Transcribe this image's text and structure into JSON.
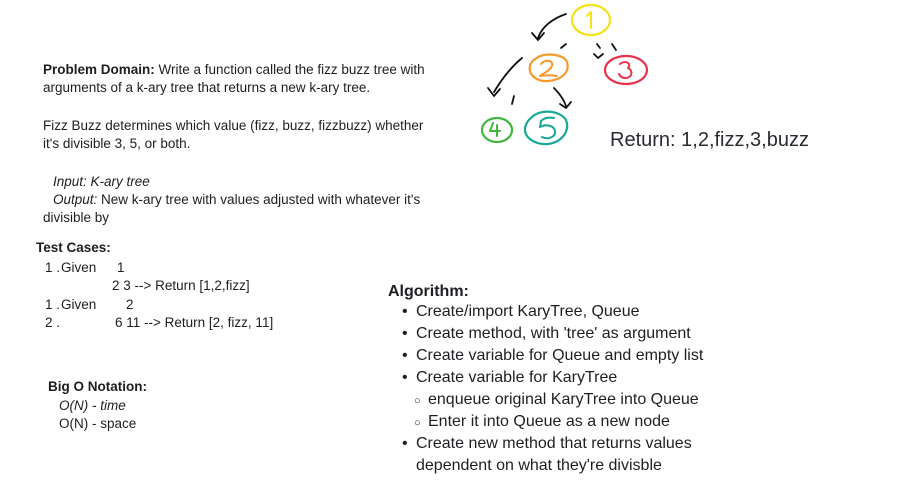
{
  "problem": {
    "label": "Problem Domain:",
    "text_line1": " Write a function called the fizz buzz tree with",
    "text_line2": "arguments of a k-ary tree that returns a new k-ary tree.",
    "fizz_line1": "Fizz Buzz determines which value (fizz, buzz, fizzbuzz) whether",
    "fizz_line2": "it's divisible 3, 5, or both."
  },
  "io": {
    "input": "Input: K-ary tree",
    "output_label": "Output:",
    "output_text": "  New k-ary tree with values adjusted with whatever it's",
    "output_text2": "divisible by"
  },
  "tests": {
    "heading": "Test Cases:",
    "case1_num": "1 .",
    "case1_given": "Given",
    "case1_root": "1",
    "case1_children": "2 3 --> Return [1,2,fizz]",
    "case2_num": "1 .",
    "case2_given": "Given",
    "case2_root": "2",
    "case3_num": "2 .",
    "case3_children": "6 11 --> Return [2, fizz, 11]"
  },
  "bigo": {
    "heading": "Big O Notation:",
    "time": "O(N) - time",
    "space": "O(N) - space"
  },
  "algorithm": {
    "heading": "Algorithm:",
    "items": [
      "Create/import KaryTree, Queue",
      "Create method, with 'tree' as argument",
      "Create variable for Queue and empty list",
      "Create variable for KaryTree"
    ],
    "subitems": [
      "enqueue original KaryTree into Queue",
      "Enter it into Queue as a new node"
    ],
    "last_item_line1": "Create new method that returns values",
    "last_item_line2": "dependent on what they're divisble"
  },
  "diagram": {
    "nodes": [
      "1",
      "2",
      "3",
      "4",
      "5"
    ],
    "return_text": "Return: 1,2,fizz,3,buzz",
    "colors": {
      "node1": "#f2e21a",
      "node2": "#f59a2a",
      "node3": "#e8324a",
      "node4": "#43b53e",
      "node5": "#17a898",
      "ink": "#111111"
    }
  }
}
